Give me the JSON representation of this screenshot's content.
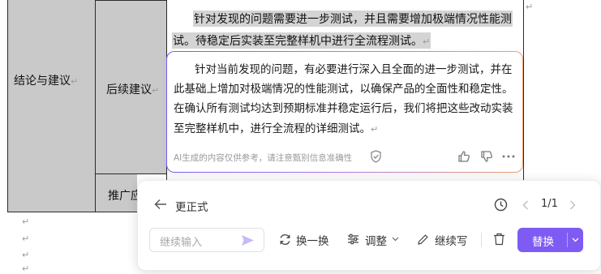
{
  "table": {
    "conclusion_label": "结论与建议",
    "followup_label": "后续建议",
    "promotion_label": "推广应"
  },
  "paragraph_mark": "↵",
  "original_text": {
    "line1": "针对发现的问题需要进一步测试，并且需要增加极端情况性能测",
    "line2": "试。待稳定后实装至完整样机中进行全流程测试。"
  },
  "ai_result": {
    "line1": "针对当前发现的问题，有必要进行深入且全面的进一步测试，并在",
    "line2": "此基础上增加对极端情况的性能测试，以确保产品的全面性和稳定性。",
    "line3": "在确认所有测试均达到预期标准并稳定运行后，我们将把这些改动实装",
    "line4": "至完整样机中，进行全流程的详细测试。",
    "disclaimer": "AI生成的内容仅供参考，请注意甄别信息准确性"
  },
  "panel": {
    "back_label": "更正式",
    "page_indicator": "1/1",
    "input_placeholder": "继续输入",
    "swap_label": "换一换",
    "adjust_label": "调整",
    "continue_label": "继续写",
    "replace_label": "替换"
  },
  "colors": {
    "accent": "#7e5cf3",
    "table_grey": "#c9c9c9"
  }
}
